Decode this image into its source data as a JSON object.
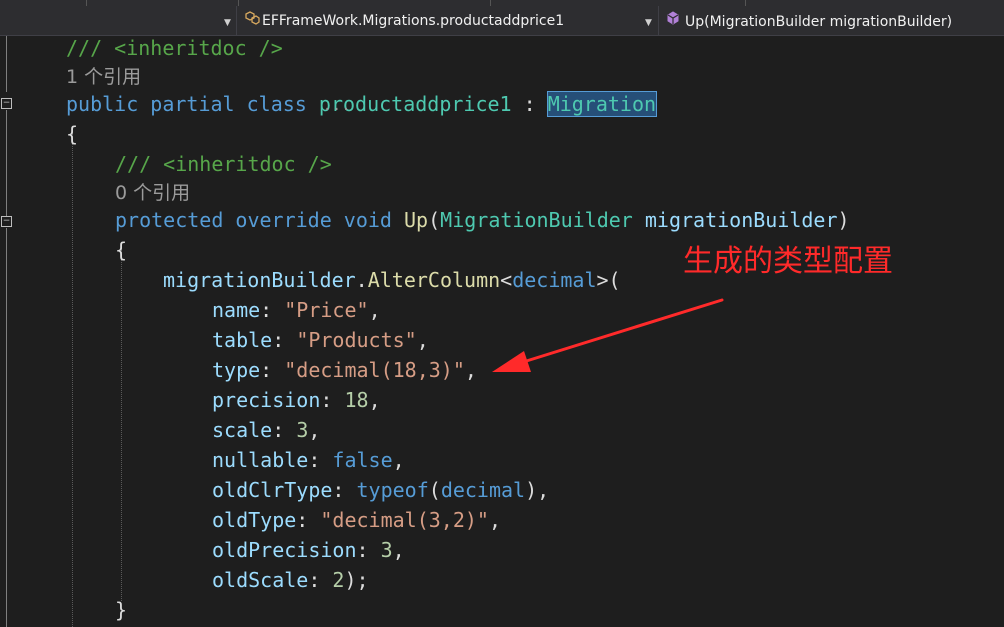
{
  "navbar": {
    "class_path": "EFFrameWork.Migrations.productaddprice1",
    "member": "Up(MigrationBuilder migrationBuilder)"
  },
  "code": {
    "l1": {
      "comment": "/// <inheritdoc />"
    },
    "l2": {
      "codelens": "1 个引用"
    },
    "l3": {
      "kw1": "public",
      "kw2": "partial",
      "kw3": "class",
      "name": "productaddprice1",
      "sep": " : ",
      "base": "Migration"
    },
    "l4": {
      "brace": "{"
    },
    "l5": {
      "comment": "/// <inheritdoc />"
    },
    "l6": {
      "codelens": "0 个引用"
    },
    "l7": {
      "kw1": "protected",
      "kw2": "override",
      "kw3": "void",
      "method": "Up",
      "p_open": "(",
      "ptype": "MigrationBuilder",
      "pname": "migrationBuilder",
      "p_close": ")"
    },
    "l8": {
      "brace": "{"
    },
    "l9": {
      "obj": "migrationBuilder",
      "dot": ".",
      "method": "AlterColumn",
      "lt": "<",
      "generic": "decimal",
      "gt": ">("
    },
    "l10": {
      "name": "name",
      "colon": ": ",
      "value": "\"Price\"",
      "end": ","
    },
    "l11": {
      "name": "table",
      "colon": ": ",
      "value": "\"Products\"",
      "end": ","
    },
    "l12": {
      "name": "type",
      "colon": ": ",
      "value": "\"decimal(18,3)\"",
      "end": ","
    },
    "l13": {
      "name": "precision",
      "colon": ": ",
      "value": "18",
      "end": ","
    },
    "l14": {
      "name": "scale",
      "colon": ": ",
      "value": "3",
      "end": ","
    },
    "l15": {
      "name": "nullable",
      "colon": ": ",
      "value": "false",
      "end": ","
    },
    "l16": {
      "name": "oldClrType",
      "colon": ": ",
      "kw": "typeof",
      "open": "(",
      "value": "decimal",
      "close": "),"
    },
    "l17": {
      "name": "oldType",
      "colon": ": ",
      "value": "\"decimal(3,2)\"",
      "end": ","
    },
    "l18": {
      "name": "oldPrecision",
      "colon": ": ",
      "value": "3",
      "end": ","
    },
    "l19": {
      "name": "oldScale",
      "colon": ": ",
      "value": "2",
      "end": ");"
    },
    "l20": {
      "brace": "}"
    }
  },
  "annotation": {
    "text": "生成的类型配置",
    "color": "#ff2a2a"
  },
  "colors": {
    "keyword": "#569cd6",
    "type": "#4ec9b0",
    "method": "#dcdcaa",
    "string": "#d69d85",
    "number": "#b5cea8",
    "param": "#9cdcfe",
    "comment": "#57a64a"
  }
}
